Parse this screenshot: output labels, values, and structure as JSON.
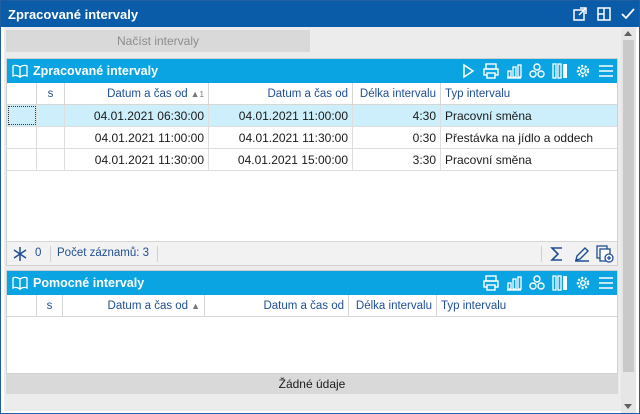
{
  "window": {
    "title": "Zpracované intervaly",
    "icons": [
      "popout-icon",
      "restore-icon",
      "confirm-icon"
    ]
  },
  "actions": {
    "load_intervals_label": "Načíst intervaly"
  },
  "panel_main": {
    "title": "Zpracované intervaly",
    "toolbar_icons": [
      "play-icon",
      "print-icon",
      "chart-icon",
      "group-icon",
      "columns-icon",
      "settings-icon",
      "menu-icon"
    ],
    "columns": [
      "s",
      "Datum a čas od",
      "Datum a čas od",
      "Délka intervalu",
      "Typ intervalu"
    ],
    "rows": [
      {
        "s": "",
        "from": "04.01.2021 06:30:00",
        "from2": "04.01.2021 11:00:00",
        "length": "4:30",
        "type": "Pracovní směna"
      },
      {
        "s": "",
        "from": "04.01.2021 11:00:00",
        "from2": "04.01.2021 11:30:00",
        "length": "0:30",
        "type": "Přestávka na jídlo a oddech"
      },
      {
        "s": "",
        "from": "04.01.2021 11:30:00",
        "from2": "04.01.2021 15:00:00",
        "length": "3:30",
        "type": "Pracovní směna"
      }
    ],
    "footer": {
      "marked_count": "0",
      "records_label": "Počet záznamů: 3"
    },
    "sort_indicator": "1"
  },
  "panel_aux": {
    "title": "Pomocné intervaly",
    "toolbar_icons": [
      "print-icon",
      "chart-icon",
      "group-icon",
      "columns-icon",
      "settings-icon",
      "menu-icon"
    ],
    "columns": [
      "s",
      "Datum a čas od",
      "Datum a čas od",
      "Délka intervalu",
      "Typ intervalu"
    ],
    "empty_label": "Žádné údaje"
  },
  "colors": {
    "titlebar": "#0b5ca8",
    "panel_header": "#0aa4e2",
    "selected_row": "#cdeefb",
    "column_header_text": "#1f4e96"
  }
}
